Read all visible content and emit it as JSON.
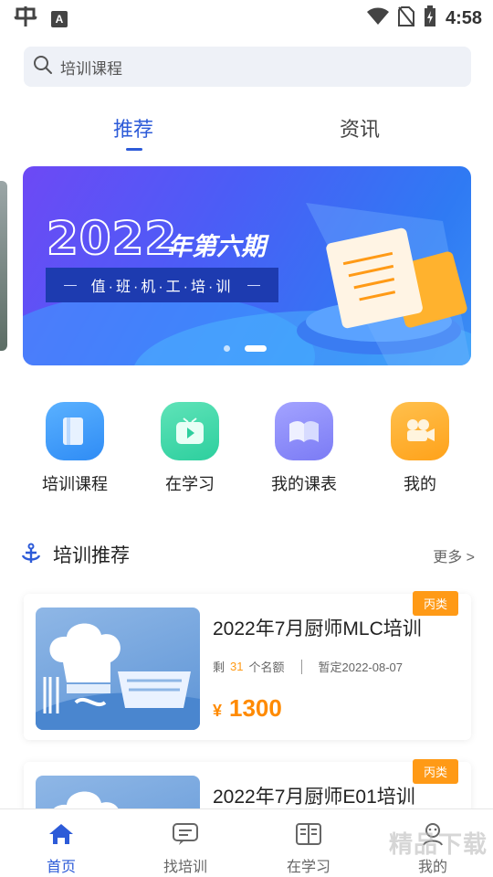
{
  "status_bar": {
    "time": "4:58",
    "a_badge": "A"
  },
  "search": {
    "placeholder": "培训课程"
  },
  "tabs": [
    {
      "label": "推荐",
      "active": true
    },
    {
      "label": "资讯",
      "active": false
    }
  ],
  "banner": {
    "year": "2022",
    "title": "年第六期",
    "subtitle": "值·班·机·工·培·训",
    "page_count": 2,
    "current_page": 2
  },
  "quick_menu": [
    {
      "label": "培训课程",
      "icon": "book-icon",
      "color": "#2f8cf5"
    },
    {
      "label": "在学习",
      "icon": "play-tv-icon",
      "color": "#2dcf9e"
    },
    {
      "label": "我的课表",
      "icon": "open-book-icon",
      "color": "#7b7bf5"
    },
    {
      "label": "我的",
      "icon": "camera-icon",
      "color": "#ffa21a"
    }
  ],
  "section": {
    "title": "培训推荐",
    "more": "更多 >"
  },
  "courses": [
    {
      "tag": "丙类",
      "title": "2022年7月厨师MLC培训",
      "remain_prefix": "剩",
      "remain_count": "31",
      "remain_suffix": "个名额",
      "date": "暂定2022-08-07",
      "currency": "¥",
      "price": "1300"
    },
    {
      "tag": "丙类",
      "title": "2022年7月厨师E01培训"
    }
  ],
  "bottom_nav": [
    {
      "label": "首页",
      "icon": "home-icon",
      "active": true
    },
    {
      "label": "找培训",
      "icon": "message-icon",
      "active": false
    },
    {
      "label": "在学习",
      "icon": "book-list-icon",
      "active": false
    },
    {
      "label": "我的",
      "icon": "profile-icon",
      "active": false
    }
  ],
  "watermark": "精品下载",
  "colors": {
    "primary": "#2d5bd8",
    "accent": "#ff9a16"
  }
}
